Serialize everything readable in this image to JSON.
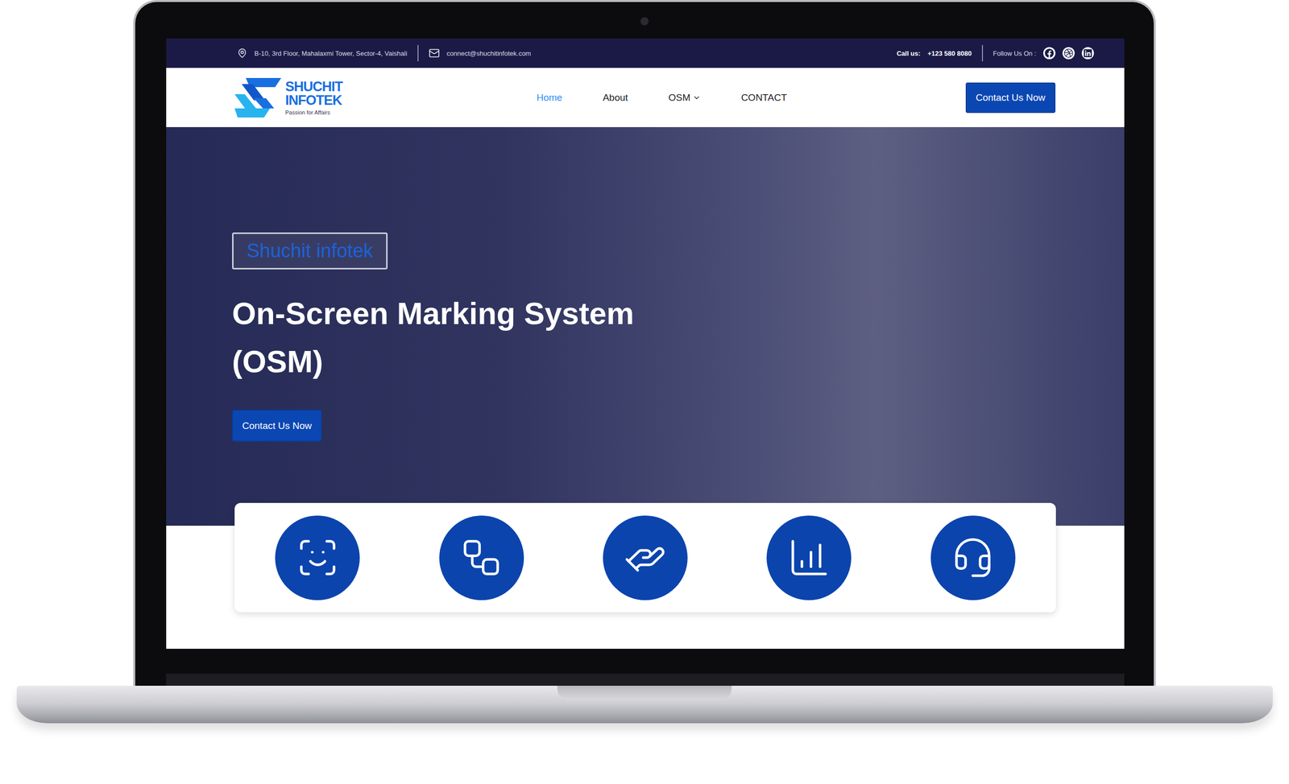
{
  "topbar": {
    "address": "B-10, 3rd Floor, Mahalaxmi Tower, Sector-4, Vaishali",
    "email": "connect@shuchitinfotek.com",
    "call_label": "Call us:",
    "phone": "+123 580 8080",
    "follow": "Follow Us On :",
    "socials": [
      {
        "kind": "facebook"
      },
      {
        "kind": "dribbble"
      },
      {
        "kind": "linkedin"
      }
    ]
  },
  "header": {
    "logo": {
      "line1": "SHUCHIT",
      "line2": "INFOTEK",
      "tagline": "Passion for Affairs"
    },
    "nav": [
      {
        "label": "Home",
        "selected": true,
        "dropdown": false
      },
      {
        "label": "About",
        "selected": false,
        "dropdown": false
      },
      {
        "label": "OSM",
        "selected": false,
        "dropdown": true
      },
      {
        "label": "CONTACT",
        "selected": false,
        "dropdown": false
      }
    ],
    "button": "Contact Us Now"
  },
  "hero": {
    "badge": "Shuchit infotek",
    "title": "On-Screen Marking System (OSM)",
    "button": "Contact Us Now"
  },
  "features": [
    {
      "kind": "scan"
    },
    {
      "kind": "workflow"
    },
    {
      "kind": "service"
    },
    {
      "kind": "growth"
    },
    {
      "kind": "support"
    }
  ]
}
